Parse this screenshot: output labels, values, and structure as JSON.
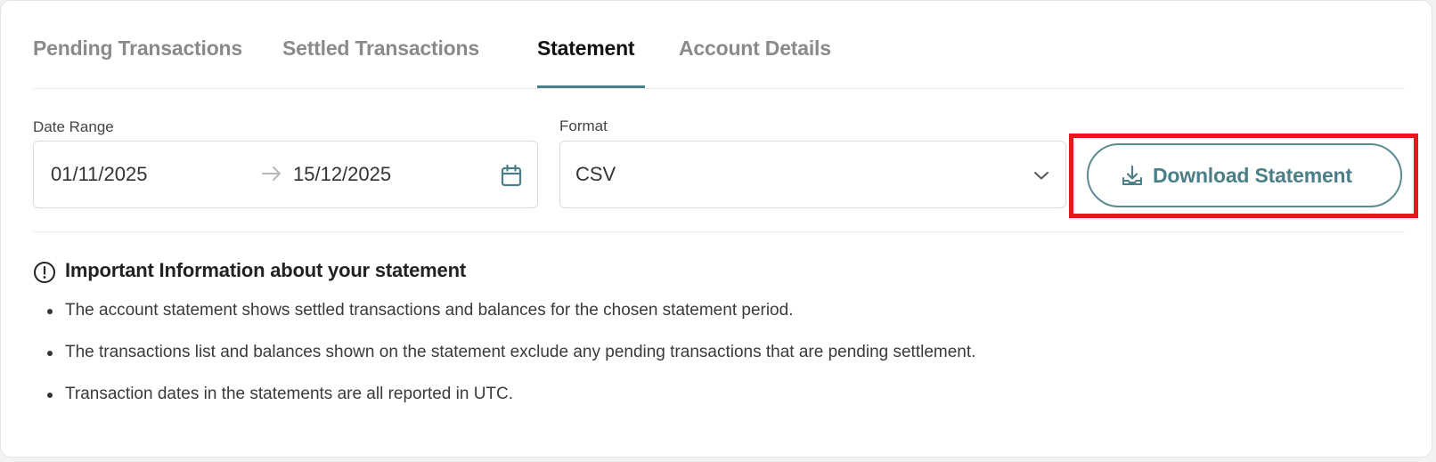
{
  "tabs": [
    {
      "label": "Pending Transactions",
      "active": false
    },
    {
      "label": "Settled Transactions",
      "active": false
    },
    {
      "label": "Statement",
      "active": true
    },
    {
      "label": "Account Details",
      "active": false
    }
  ],
  "date_range": {
    "label": "Date Range",
    "start": "01/11/2025",
    "end": "15/12/2025",
    "separator_icon": "arrow-right-icon",
    "calendar_icon": "calendar-icon"
  },
  "format": {
    "label": "Format",
    "selected": "CSV",
    "dropdown_icon": "chevron-down-icon"
  },
  "download": {
    "label": "Download Statement",
    "icon": "download-tray-icon",
    "highlighted": true,
    "highlight_color": "#e11b1b"
  },
  "info": {
    "icon": "exclamation-circle-icon",
    "title": "Important Information about your statement",
    "items": [
      "The account statement shows settled transactions and balances for the chosen statement period.",
      "The transactions list and balances shown on the statement exclude any pending transactions that are pending settlement.",
      "Transaction dates in the statements are all reported in UTC."
    ]
  },
  "colors": {
    "accent": "#4b7f87",
    "inactive_tab": "#8a8a8a",
    "active_tab": "#111111"
  }
}
